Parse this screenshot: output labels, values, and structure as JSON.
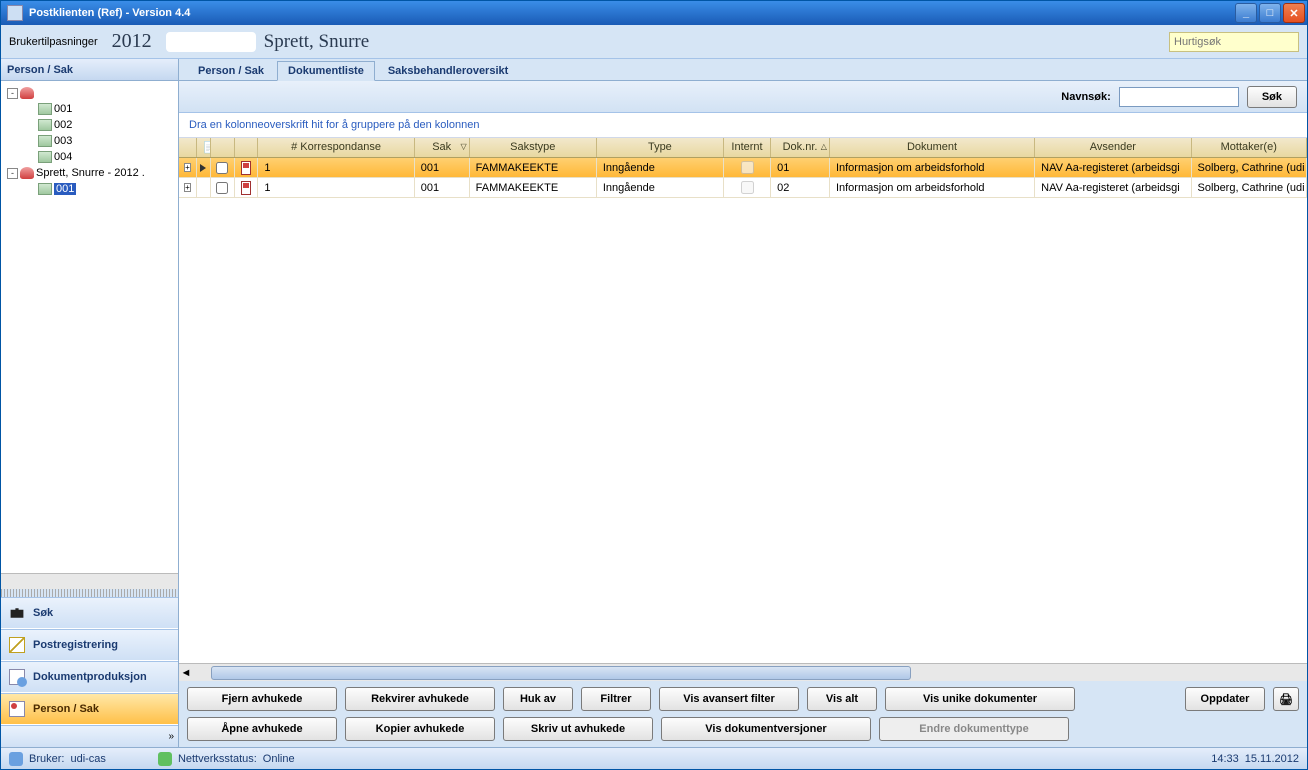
{
  "window": {
    "title": "Postklienten (Ref) - Version 4.4"
  },
  "toolbar": {
    "brukertilpasninger": "Brukertilpasninger",
    "year": "2012",
    "name": "Sprett, Snurre",
    "quicksearch_placeholder": "Hurtigsøk"
  },
  "left": {
    "header": "Person / Sak",
    "tree": [
      {
        "level": 0,
        "expand": "-",
        "icon": "person",
        "label": ""
      },
      {
        "level": 1,
        "expand": "",
        "icon": "folder",
        "label": "001"
      },
      {
        "level": 1,
        "expand": "",
        "icon": "folder",
        "label": "002"
      },
      {
        "level": 1,
        "expand": "",
        "icon": "folder",
        "label": "003"
      },
      {
        "level": 1,
        "expand": "",
        "icon": "folder",
        "label": "004"
      },
      {
        "level": 0,
        "expand": "-",
        "icon": "person",
        "label": "Sprett, Snurre - 2012 ."
      },
      {
        "level": 1,
        "expand": "",
        "icon": "folder",
        "label": "001",
        "selected": true
      }
    ],
    "nav": [
      {
        "key": "sok",
        "label": "Søk",
        "icon": "bino"
      },
      {
        "key": "postreg",
        "label": "Postregistrering",
        "icon": "env"
      },
      {
        "key": "dokprod",
        "label": "Dokumentproduksjon",
        "icon": "doc"
      },
      {
        "key": "personsak",
        "label": "Person / Sak",
        "icon": "ps",
        "active": true
      }
    ]
  },
  "tabs": [
    {
      "key": "personsak",
      "label": "Person / Sak"
    },
    {
      "key": "dokumentliste",
      "label": "Dokumentliste",
      "active": true
    },
    {
      "key": "sbo",
      "label": "Saksbehandleroversikt"
    }
  ],
  "search": {
    "label": "Navnsøk:",
    "button": "Søk",
    "value": ""
  },
  "grid": {
    "group_hint": "Dra en kolonneoverskrift hit for å gruppere på den kolonnen",
    "columns": {
      "corr": "# Korrespondanse",
      "sak": "Sak",
      "sakstype": "Sakstype",
      "type": "Type",
      "internt": "Internt",
      "doknr": "Dok.nr.",
      "dokument": "Dokument",
      "avsender": "Avsender",
      "mottaker": "Mottaker(e)"
    },
    "rows": [
      {
        "selected": true,
        "corr": "1",
        "sak": "001",
        "sakstype": "FAMMAKEEKTE",
        "type": "Inngående",
        "internt": false,
        "doknr": "01",
        "dokument": "Informasjon om arbeidsforhold",
        "avsender": "NAV Aa-registeret (arbeidsgi",
        "mottaker": "Solberg, Cathrine (udi"
      },
      {
        "selected": false,
        "corr": "1",
        "sak": "001",
        "sakstype": "FAMMAKEEKTE",
        "type": "Inngående",
        "internt": false,
        "doknr": "02",
        "dokument": "Informasjon om arbeidsforhold",
        "avsender": "NAV Aa-registeret (arbeidsgi",
        "mottaker": "Solberg, Cathrine (udi"
      }
    ]
  },
  "buttons": {
    "fjern": "Fjern avhukede",
    "rekvirer": "Rekvirer avhukede",
    "hukav": "Huk av",
    "filtrer": "Filtrer",
    "visavansert": "Vis avansert filter",
    "visalt": "Vis alt",
    "visunike": "Vis unike dokumenter",
    "oppdater": "Oppdater",
    "apne": "Åpne avhukede",
    "kopier": "Kopier avhukede",
    "skrivut": "Skriv ut avhukede",
    "visversjoner": "Vis dokumentversjoner",
    "endretype": "Endre dokumenttype"
  },
  "status": {
    "bruker_label": "Bruker:",
    "bruker_value": "udi-cas",
    "nett_label": "Nettverksstatus:",
    "nett_value": "Online",
    "time": "14:33",
    "date": "15.11.2012"
  }
}
